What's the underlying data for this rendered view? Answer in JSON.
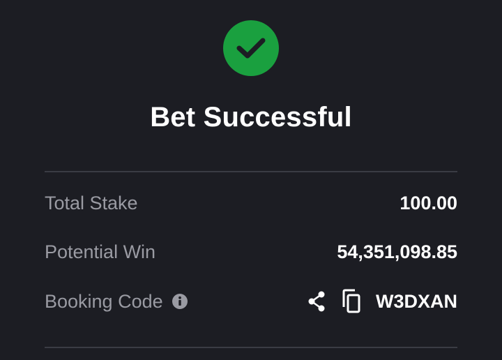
{
  "status": {
    "icon": "check-circle-icon",
    "title": "Bet Successful",
    "color": "#1aa03f"
  },
  "summary": {
    "total_stake_label": "Total Stake",
    "total_stake_value": "100.00",
    "potential_win_label": "Potential Win",
    "potential_win_value": "54,351,098.85",
    "booking_code_label": "Booking Code",
    "booking_code_value": "W3DXAN",
    "icons": [
      "info-icon",
      "share-icon",
      "copy-icon"
    ]
  },
  "colors": {
    "background": "#1c1d23",
    "label": "#9a9ba3",
    "value": "#ffffff",
    "divider": "#3a3c44"
  }
}
